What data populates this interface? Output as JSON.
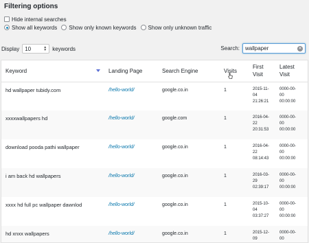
{
  "heading": "Filtering options",
  "filters": {
    "hide_internal": "Hide internal searches",
    "options": [
      "Show all keywords",
      "Show only known keywords",
      "Show only unknown traffic"
    ]
  },
  "display": {
    "label": "Display",
    "value": "10",
    "suffix": "keywords"
  },
  "search": {
    "label": "Search:",
    "value": "wallpaper"
  },
  "table": {
    "headers": {
      "keyword": "Keyword",
      "landing": "Landing Page",
      "engine": "Search Engine",
      "visits": "Visits",
      "first": "First Visit",
      "latest": "Latest Visit"
    },
    "rows": [
      {
        "keyword": "hd wallpaper tubidy.com",
        "landing": "/hello-world/",
        "engine": "google.co.in",
        "visits": "1",
        "first": "2015-11-\n04\n21:26:21",
        "latest": "0000-00-\n00\n00:00:00"
      },
      {
        "keyword": "xxxxwallpapers hd",
        "landing": "/hello-world/",
        "engine": "google.com",
        "visits": "1",
        "first": "2016-04-\n22\n20:31:53",
        "latest": "0000-00-\n00\n00:00:00"
      },
      {
        "keyword": "download pooda pathi wallpaper",
        "landing": "/hello-world/",
        "engine": "google.co.in",
        "visits": "1",
        "first": "2016-04-\n22\n08:14:43",
        "latest": "0000-00-\n00\n00:00:00"
      },
      {
        "keyword": "i am back hd wallpapers",
        "landing": "/hello-world/",
        "engine": "google.co.in",
        "visits": "1",
        "first": "2016-03-\n29\n02:39:17",
        "latest": "0000-00-\n00\n00:00:00"
      },
      {
        "keyword": "xxxx hd full pc wallpaper dawnlod",
        "landing": "/hello-world/",
        "engine": "google.co.in",
        "visits": "1",
        "first": "2015-10-\n04\n03:37:27",
        "latest": "0000-00-\n00\n00:00:00"
      },
      {
        "keyword": "hd xnxx wallpapers",
        "landing": "/hello-world/",
        "engine": "google.co.in",
        "visits": "1",
        "first": "2015-12-\n09",
        "latest": "0000-00-\n00"
      }
    ]
  }
}
